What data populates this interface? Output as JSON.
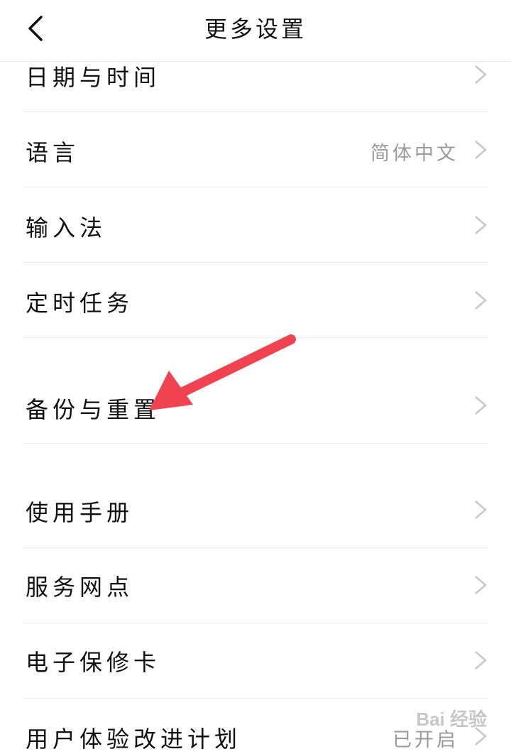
{
  "header": {
    "title": "更多设置",
    "back_icon": "chevron-left-icon"
  },
  "rows": [
    {
      "label": "日期与时间",
      "value": ""
    },
    {
      "label": "语言",
      "value": "简体中文"
    },
    {
      "label": "输入法",
      "value": ""
    },
    {
      "label": "定时任务",
      "value": ""
    },
    {
      "label": "备份与重置",
      "value": ""
    },
    {
      "label": "使用手册",
      "value": ""
    },
    {
      "label": "服务网点",
      "value": ""
    },
    {
      "label": "电子保修卡",
      "value": ""
    },
    {
      "label": "用户体验改进计划",
      "value": "已开启"
    }
  ],
  "annotation": {
    "color": "#f0434f",
    "icon": "red-arrow-icon"
  },
  "watermark": {
    "text": "Bai 经验"
  }
}
